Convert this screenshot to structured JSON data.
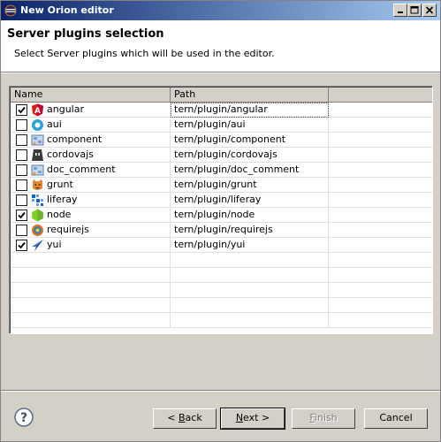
{
  "window": {
    "title": "New Orion editor"
  },
  "header": {
    "title": "Server plugins selection",
    "description": "Select Server plugins which will be used in the editor."
  },
  "table": {
    "columns": [
      "Name",
      "Path"
    ],
    "rows": [
      {
        "name": "angular",
        "path": "tern/plugin/angular",
        "checked": true,
        "icon": "angular-icon"
      },
      {
        "name": "aui",
        "path": "tern/plugin/aui",
        "checked": false,
        "icon": "aui-icon"
      },
      {
        "name": "component",
        "path": "tern/plugin/component",
        "checked": false,
        "icon": "component-icon"
      },
      {
        "name": "cordovajs",
        "path": "tern/plugin/cordovajs",
        "checked": false,
        "icon": "cordova-icon"
      },
      {
        "name": "doc_comment",
        "path": "tern/plugin/doc_comment",
        "checked": false,
        "icon": "doc-comment-icon"
      },
      {
        "name": "grunt",
        "path": "tern/plugin/grunt",
        "checked": false,
        "icon": "grunt-icon"
      },
      {
        "name": "liferay",
        "path": "tern/plugin/liferay",
        "checked": false,
        "icon": "liferay-icon"
      },
      {
        "name": "node",
        "path": "tern/plugin/node",
        "checked": true,
        "icon": "node-icon"
      },
      {
        "name": "requirejs",
        "path": "tern/plugin/requirejs",
        "checked": false,
        "icon": "requirejs-icon"
      },
      {
        "name": "yui",
        "path": "tern/plugin/yui",
        "checked": true,
        "icon": "yui-icon"
      }
    ]
  },
  "buttons": {
    "back": {
      "mnemonic": "B",
      "rest": "ack",
      "prefix": "< "
    },
    "next": {
      "mnemonic": "N",
      "rest": "ext >"
    },
    "finish": {
      "mnemonic": "F",
      "rest": "inish"
    },
    "cancel": "Cancel"
  },
  "colors": {
    "titlebar_start": "#0a246a",
    "titlebar_end": "#a6caf0",
    "dialog_bg": "#d4d0c8"
  }
}
